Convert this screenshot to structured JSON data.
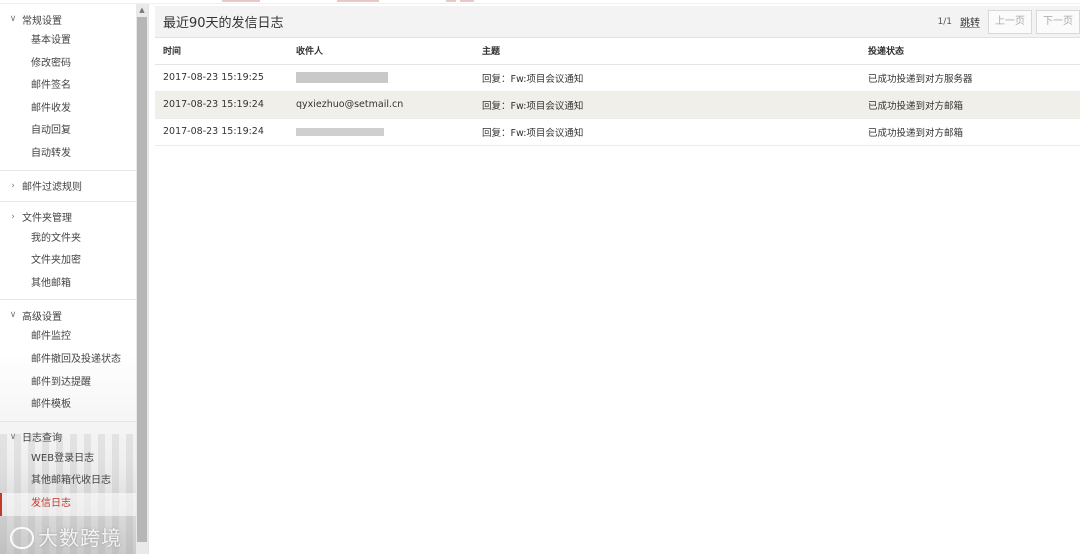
{
  "sidebar": {
    "groups": [
      {
        "label": "常规设置",
        "expanded": true,
        "items": [
          "基本设置",
          "修改密码",
          "邮件签名",
          "邮件收发",
          "自动回复",
          "自动转发"
        ]
      },
      {
        "label": "邮件过滤规则",
        "expanded": false,
        "items": []
      },
      {
        "label": "文件夹管理",
        "expanded": false,
        "items": [
          "我的文件夹",
          "文件夹加密",
          "其他邮箱"
        ]
      },
      {
        "label": "高级设置",
        "expanded": true,
        "items": [
          "邮件监控",
          "邮件撤回及投递状态",
          "邮件到达提醒",
          "邮件模板"
        ]
      },
      {
        "label": "日志查询",
        "expanded": true,
        "items": [
          "WEB登录日志",
          "其他邮箱代收日志",
          "发信日志"
        ]
      }
    ],
    "active_item": "发信日志"
  },
  "header": {
    "title": "最近90天的发信日志",
    "pager": {
      "info": "1/1",
      "jump_label": "跳转",
      "prev_label": "上一页",
      "next_label": "下一页"
    }
  },
  "table": {
    "columns": [
      "时间",
      "收件人",
      "主题",
      "投递状态"
    ],
    "rows": [
      {
        "time": "2017-08-23 15:19:25",
        "recipient": "",
        "subject": "回复：Fw:项目会议通知",
        "status": "已成功投递到对方服务器"
      },
      {
        "time": "2017-08-23 15:19:24",
        "recipient": "qyxiezhuo@setmail.cn",
        "subject": "回复：Fw:项目会议通知",
        "status": "已成功投递到对方邮箱"
      },
      {
        "time": "2017-08-23 15:19:24",
        "recipient": "",
        "subject": "回复：Fw:项目会议通知",
        "status": "已成功投递到对方邮箱"
      }
    ]
  },
  "watermark": {
    "text": "大数跨境"
  },
  "icons": {
    "expanded": "chevron-down-icon",
    "collapsed": "chevron-right-icon",
    "scroll_up": "triangle-up-icon"
  },
  "colors": {
    "highlight_row": "#f1efe9",
    "active_item": "#c0392b",
    "header_bg": "#f3f3f3"
  }
}
